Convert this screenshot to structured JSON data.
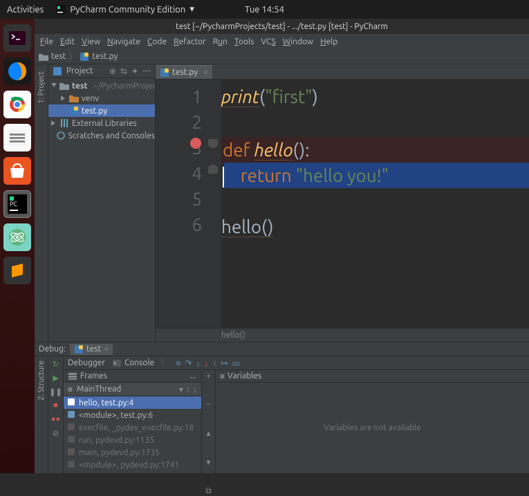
{
  "topbar": {
    "activities": "Activities",
    "app": "PyCharm Community Edition",
    "clock": "Tue 14:54"
  },
  "window_title": "test [~/PycharmProjects/test] - .../test.py [test] - PyCharm",
  "menu": [
    "File",
    "Edit",
    "View",
    "Navigate",
    "Code",
    "Refactor",
    "Run",
    "Tools",
    "VCS",
    "Window",
    "Help"
  ],
  "nav": {
    "project": "test",
    "file": "test.py"
  },
  "side_label": "1: Project",
  "project_tool": {
    "title": "Project",
    "root": "test",
    "root_path": "~/PycharmProjects",
    "venv": "venv",
    "file": "test.py",
    "ext_libs": "External Libraries",
    "scratches": "Scratches and Consoles"
  },
  "editor": {
    "tab": "test.py",
    "lines": [
      "1",
      "2",
      "3",
      "4",
      "5",
      "6"
    ],
    "line1_fn": "print",
    "line1_paren_open": "(",
    "line1_str": "\"first\"",
    "line1_paren_close": ")",
    "line3_def": "def ",
    "line3_name": "hello",
    "line3_rest": "():",
    "line4_indent": "    ",
    "line4_ret": "return ",
    "line4_str": "\"hello you!\"",
    "line6_call": "hello",
    "line6_p": "()",
    "breadcrumb": "hello()"
  },
  "debug": {
    "title": "Debug:",
    "config": "test",
    "tab_debugger": "Debugger",
    "tab_console": "Console",
    "frames_label": "Frames",
    "vars_label": "Variables",
    "thread": "MainThread",
    "stack": [
      "hello, test.py:4",
      "<module>, test.py:6",
      "execfile, _pydev_execfile.py:18",
      "run, pydevd.py:1135",
      "main, pydevd.py:1735",
      "<module>, pydevd.py:1741"
    ],
    "vars_empty": "Variables are not available"
  },
  "bottom_side": "2: Structure"
}
